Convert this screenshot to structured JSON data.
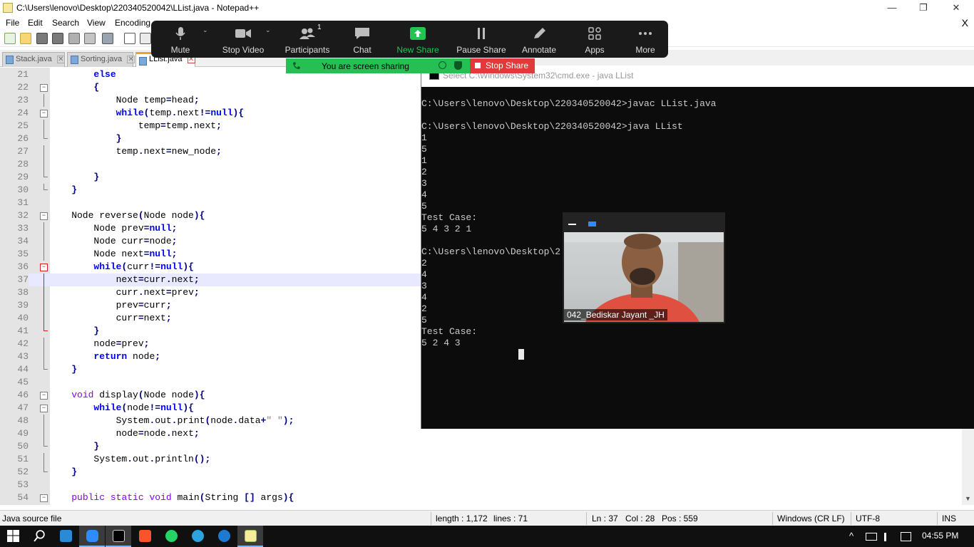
{
  "window": {
    "title": "C:\\Users\\lenovo\\Desktop\\220340520042\\LList.java - Notepad++",
    "minimize": "—",
    "maximize": "❐",
    "close": "✕"
  },
  "menu": {
    "items": [
      "File",
      "Edit",
      "Search",
      "View",
      "Encoding"
    ],
    "close_doc": "X"
  },
  "tabs": [
    {
      "label": "Stack.java",
      "close": "✕"
    },
    {
      "label": "Sorting.java",
      "close": "✕"
    },
    {
      "label": "LList.java",
      "close": "✕"
    }
  ],
  "editor": {
    "lines": [
      {
        "n": "21",
        "text": "        else"
      },
      {
        "n": "22",
        "text": "        {"
      },
      {
        "n": "23",
        "text": "            Node temp=head;"
      },
      {
        "n": "24",
        "text": "            while(temp.next!=null){"
      },
      {
        "n": "25",
        "text": "                temp=temp.next;"
      },
      {
        "n": "26",
        "text": "            }"
      },
      {
        "n": "27",
        "text": "            temp.next=new_node;"
      },
      {
        "n": "28",
        "text": ""
      },
      {
        "n": "29",
        "text": "        }"
      },
      {
        "n": "30",
        "text": "    }"
      },
      {
        "n": "31",
        "text": ""
      },
      {
        "n": "32",
        "text": "    Node reverse(Node node){"
      },
      {
        "n": "33",
        "text": "        Node prev=null;"
      },
      {
        "n": "34",
        "text": "        Node curr=node;"
      },
      {
        "n": "35",
        "text": "        Node next=null;"
      },
      {
        "n": "36",
        "text": "        while(curr!=null){"
      },
      {
        "n": "37",
        "text": "            next=curr.next;"
      },
      {
        "n": "38",
        "text": "            curr.next=prev;"
      },
      {
        "n": "39",
        "text": "            prev=curr;"
      },
      {
        "n": "40",
        "text": "            curr=next;"
      },
      {
        "n": "41",
        "text": "        }"
      },
      {
        "n": "42",
        "text": "        node=prev;"
      },
      {
        "n": "43",
        "text": "        return node;"
      },
      {
        "n": "44",
        "text": "    }"
      },
      {
        "n": "45",
        "text": ""
      },
      {
        "n": "46",
        "text": "    void display(Node node){"
      },
      {
        "n": "47",
        "text": "        while(node!=null){"
      },
      {
        "n": "48",
        "text": "            System.out.print(node.data+\" \");"
      },
      {
        "n": "49",
        "text": "            node=node.next;"
      },
      {
        "n": "50",
        "text": "        }"
      },
      {
        "n": "51",
        "text": "        System.out.println();"
      },
      {
        "n": "52",
        "text": "    }"
      },
      {
        "n": "53",
        "text": ""
      },
      {
        "n": "54",
        "text": "    public static void main(String [] args){"
      }
    ],
    "current_line": "37"
  },
  "status": {
    "filetype": "Java source file",
    "length": "length : 1,172",
    "lines": "lines : 71",
    "ln": "Ln : 37",
    "col": "Col : 28",
    "pos": "Pos : 559",
    "eol": "Windows (CR LF)",
    "encoding": "UTF-8",
    "mode": "INS"
  },
  "zoom": {
    "buttons": [
      {
        "label": "Mute",
        "icon": "microphone-icon"
      },
      {
        "label": "Stop Video",
        "icon": "video-camera-icon"
      },
      {
        "label": "Participants",
        "icon": "participants-icon",
        "count": "1"
      },
      {
        "label": "Chat",
        "icon": "chat-bubble-icon"
      },
      {
        "label": "New Share",
        "icon": "share-arrow-icon"
      },
      {
        "label": "Pause Share",
        "icon": "pause-icon"
      },
      {
        "label": "Annotate",
        "icon": "pen-icon"
      },
      {
        "label": "Apps",
        "icon": "apps-icon"
      },
      {
        "label": "More",
        "icon": "more-dots-icon"
      }
    ],
    "sharing_text": "You are screen sharing",
    "stop_share": "Stop Share",
    "colors": {
      "bar": "#1a1a1a",
      "share_green": "#26c052",
      "stop_red": "#e23a3a",
      "new_share_icon": "#23c552"
    }
  },
  "cmd": {
    "title": "Select C:\\Windows\\System32\\cmd.exe - java  LList",
    "lines": [
      "C:\\Users\\lenovo\\Desktop\\220340520042>javac LList.java",
      "",
      "C:\\Users\\lenovo\\Desktop\\220340520042>java LList",
      "1",
      "5",
      "1",
      "2",
      "3",
      "4",
      "5",
      "Test Case:",
      "5 4 3 2 1",
      "",
      "C:\\Users\\lenovo\\Desktop\\2",
      "2",
      "4",
      "3",
      "4",
      "2",
      "5",
      "Test Case:",
      "5 2 4 3"
    ]
  },
  "video": {
    "participant_name": "042_Bediskar Jayant _JH"
  },
  "taskbar": {
    "apps": [
      "start-icon",
      "search-icon",
      "vscode-icon",
      "zoom-icon",
      "cmd-icon",
      "brave-icon",
      "whatsapp-icon",
      "telegram-icon",
      "edge-icon",
      "notepadpp-icon"
    ],
    "tray_chevron": "^",
    "clock": "04:55 PM"
  }
}
